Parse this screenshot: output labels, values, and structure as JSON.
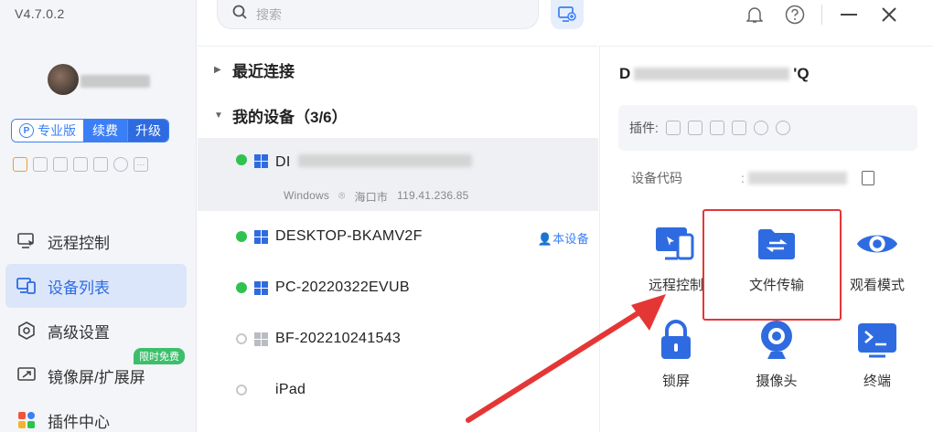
{
  "app": {
    "version": "V4.7.0.2"
  },
  "user": {
    "badges": {
      "pro": "专业版",
      "renew": "续费",
      "upgrade": "升级"
    }
  },
  "nav": [
    {
      "label": "远程控制"
    },
    {
      "label": "设备列表"
    },
    {
      "label": "高级设置"
    },
    {
      "label": "镜像屏/扩展屏",
      "badge": "限时免费"
    },
    {
      "label": "插件中心"
    }
  ],
  "search": {
    "placeholder": "搜索"
  },
  "groups": {
    "recent": "最近连接",
    "mine": "我的设备（3/6）"
  },
  "devices": [
    {
      "name": "DI",
      "os": "Windows",
      "location": "海口市",
      "ip": "119.41.236.85"
    },
    {
      "name": "DESKTOP-BKAMV2F",
      "tag": "本设备"
    },
    {
      "name": "PC-20220322EVUB"
    },
    {
      "name": "BF-202210241543"
    },
    {
      "name": "iPad"
    }
  ],
  "panel": {
    "title_start": "D",
    "title_end": "'Q",
    "plugins_label": "插件:",
    "code_label": "设备代码",
    "code_prefix": ":",
    "actions": [
      "远程控制",
      "文件传输",
      "观看模式",
      "锁屏",
      "摄像头",
      "终端"
    ]
  },
  "colors": {
    "accent": "#3b7ff6",
    "online": "#2fc24f",
    "highlight": "#e53636"
  }
}
